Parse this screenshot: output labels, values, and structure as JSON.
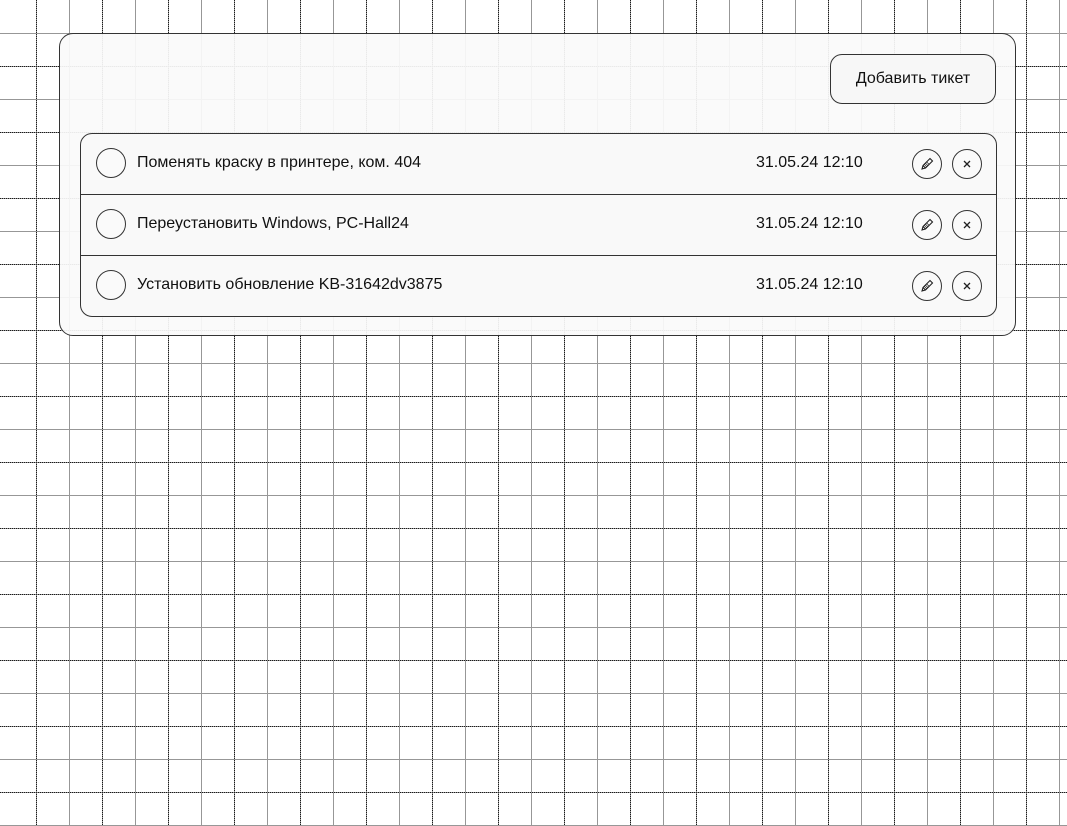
{
  "toolbar": {
    "add_ticket_label": "Добавить тикет"
  },
  "tickets": [
    {
      "title": "Поменять краску в принтере, ком. 404",
      "date": "31.05.24 12:10"
    },
    {
      "title": "Переустановить Windows, PC-Hall24",
      "date": "31.05.24 12:10"
    },
    {
      "title": "Установить обновление KB-31642dv3875",
      "date": "31.05.24 12:10"
    }
  ],
  "icons": {
    "edit": "pencil-icon",
    "delete": "close-icon",
    "complete": "checkbox-circle"
  }
}
